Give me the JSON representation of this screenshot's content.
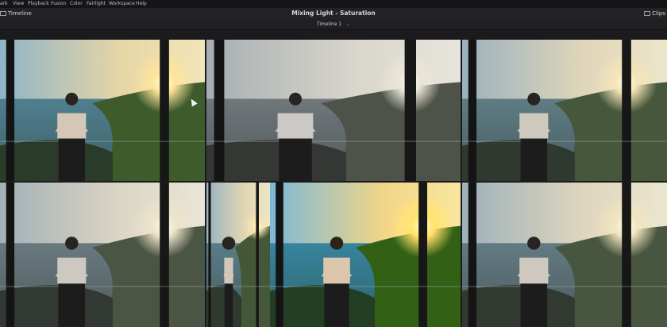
{
  "menu": {
    "items": [
      "ark",
      "View",
      "Playback",
      "Fusion",
      "Color",
      "Fairlight",
      "Workspace",
      "Help"
    ]
  },
  "titlebar": {
    "left_label": "Timeline",
    "title": "Mixing Light  -  Saturation",
    "right_label": "Clips"
  },
  "subbar": {
    "timeline_name": "Timeline 1",
    "dropdown_glyph": "⌄"
  },
  "grid": {
    "tiles": [
      {
        "saturation": 1.0,
        "selected": true
      },
      {
        "saturation": 0.2,
        "selected": false
      },
      {
        "saturation": 0.6,
        "selected": false
      },
      {
        "saturation": 0.35,
        "selected": false
      },
      {
        "saturation": 0.7,
        "selected": false
      },
      {
        "saturation": 1.6,
        "selected": false
      },
      {
        "saturation": 0.5,
        "selected": false
      }
    ],
    "accent_selected": "#e9e2c9"
  }
}
